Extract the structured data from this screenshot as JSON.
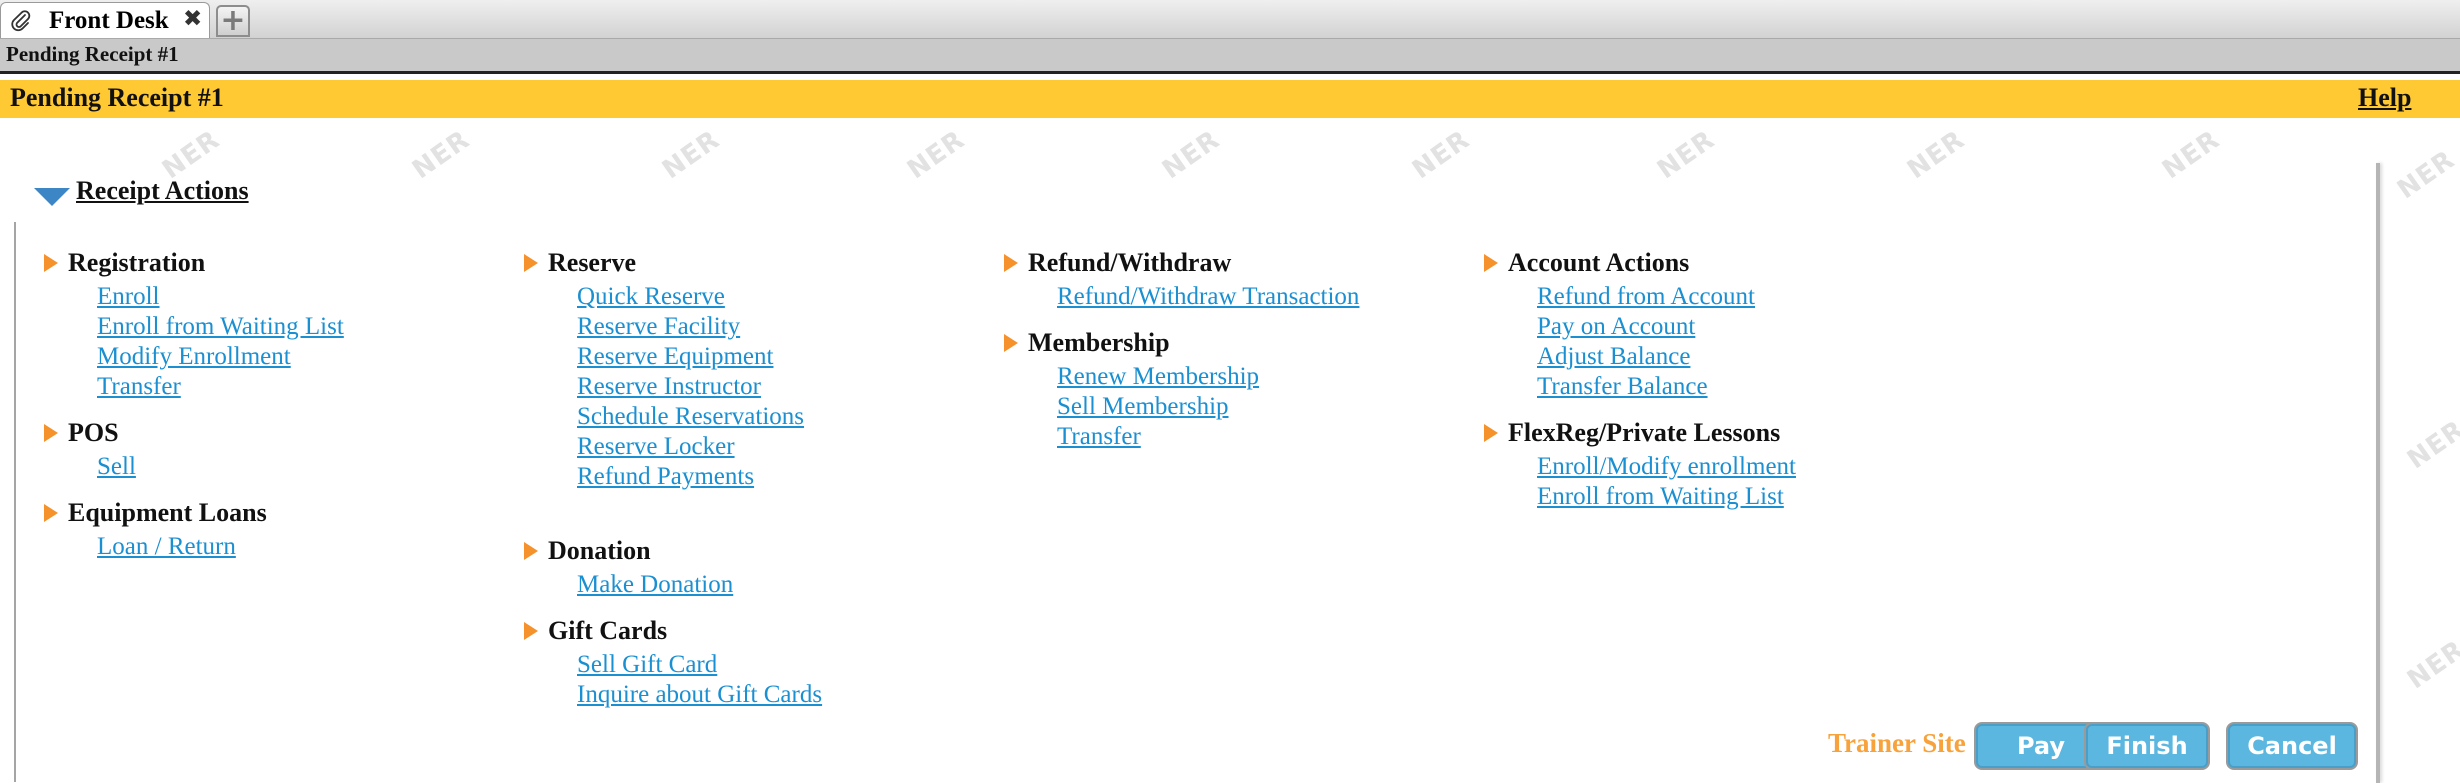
{
  "tabs": {
    "active_label": "Front Desk",
    "close_symbol": "✖",
    "add_symbol": "+"
  },
  "breadcrumb": "Pending Receipt #1",
  "header": {
    "title": "Pending Receipt #1",
    "help": "Help"
  },
  "section": {
    "title": "Receipt Actions"
  },
  "watermark": "NER",
  "groups": {
    "registration": {
      "title": "Registration",
      "links": [
        "Enroll",
        "Enroll from Waiting List",
        "Modify Enrollment",
        "Transfer"
      ]
    },
    "pos": {
      "title": "POS",
      "links": [
        "Sell"
      ]
    },
    "equipment": {
      "title": "Equipment Loans",
      "links": [
        "Loan / Return"
      ]
    },
    "reserve": {
      "title": "Reserve",
      "links": [
        "Quick Reserve",
        "Reserve Facility",
        "Reserve Equipment",
        "Reserve Instructor",
        "Schedule Reservations",
        "Reserve Locker",
        "Refund Payments"
      ]
    },
    "donation": {
      "title": "Donation",
      "links": [
        "Make Donation"
      ]
    },
    "giftcards": {
      "title": "Gift Cards",
      "links": [
        "Sell Gift Card",
        "Inquire about Gift Cards"
      ]
    },
    "refund": {
      "title": "Refund/Withdraw",
      "links": [
        "Refund/Withdraw Transaction"
      ]
    },
    "membership": {
      "title": "Membership",
      "links": [
        "Renew Membership",
        "Sell Membership",
        "Transfer"
      ]
    },
    "account": {
      "title": "Account Actions",
      "links": [
        "Refund from Account",
        "Pay on Account",
        "Adjust Balance",
        "Transfer Balance"
      ]
    },
    "flexreg": {
      "title": "FlexReg/Private Lessons",
      "links": [
        "Enroll/Modify enrollment",
        "Enroll from Waiting List"
      ]
    }
  },
  "footer": {
    "trainer_site": "Trainer Site",
    "pay": "Pay",
    "finish": "Finish",
    "cancel": "Cancel"
  },
  "colors": {
    "header_bg": "#ffc933",
    "link": "#1a8fd1",
    "group_arrow": "#f5922b",
    "button_bg": "#5bb7e0",
    "trainer_text": "#f7a23b"
  }
}
